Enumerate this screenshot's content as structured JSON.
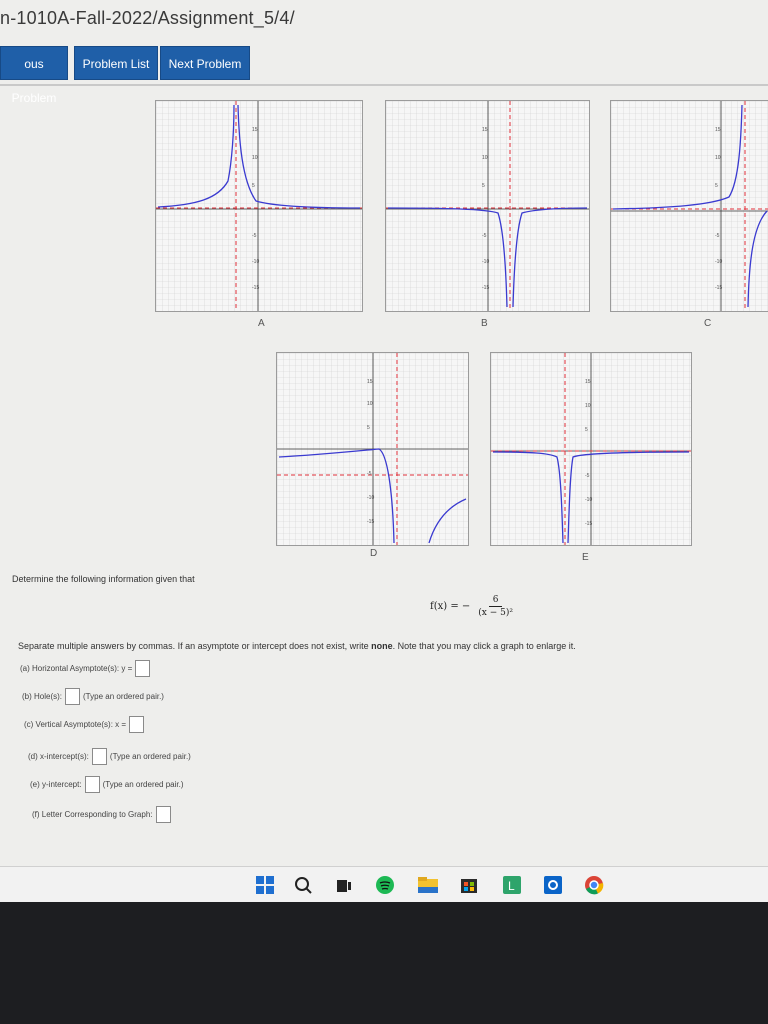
{
  "header": {
    "breadcrumb": "n-1010A-Fall-2022/Assignment_5/4/"
  },
  "nav": {
    "previous_label": "ous Problem",
    "list_label": "Problem List",
    "next_label": "Next Problem"
  },
  "graphs": [
    {
      "letter": "A"
    },
    {
      "letter": "B"
    },
    {
      "letter": "C"
    },
    {
      "letter": "D"
    },
    {
      "letter": "E"
    }
  ],
  "problem": {
    "prompt": "Determine the following information given that",
    "function_lhs": "f(x) = −",
    "numerator": "6",
    "denominator": "(x − 5)²",
    "instructions_pre": "Separate multiple answers by commas. If an asymptote or intercept does not exist, write ",
    "instructions_bold": "none",
    "instructions_post": ". Note that you may click a graph to enlarge it."
  },
  "questions": {
    "a_label": "(a) Horizontal Asymptote(s): y =",
    "b_label": "(b) Hole(s):",
    "b_hint": "(Type an ordered pair.)",
    "c_label": "(c) Vertical Asymptote(s): x =",
    "d_label": "(d) x-intercept(s):",
    "d_hint": "(Type an ordered pair.)",
    "e_label": "(e) y-intercept:",
    "e_hint": "(Type an ordered pair.)",
    "f_label": "(f) Letter Corresponding to Graph:"
  },
  "taskbar": {
    "icons": [
      "windows-icon",
      "search-icon",
      "task-view-icon",
      "spotify-icon",
      "file-explorer-icon",
      "store-icon",
      "launcher-icon",
      "outlook-icon",
      "chrome-icon"
    ]
  },
  "colors": {
    "nav_button": "#1f5fa8",
    "asymptote": "#e0303a",
    "curve": "#3a3ad0"
  }
}
